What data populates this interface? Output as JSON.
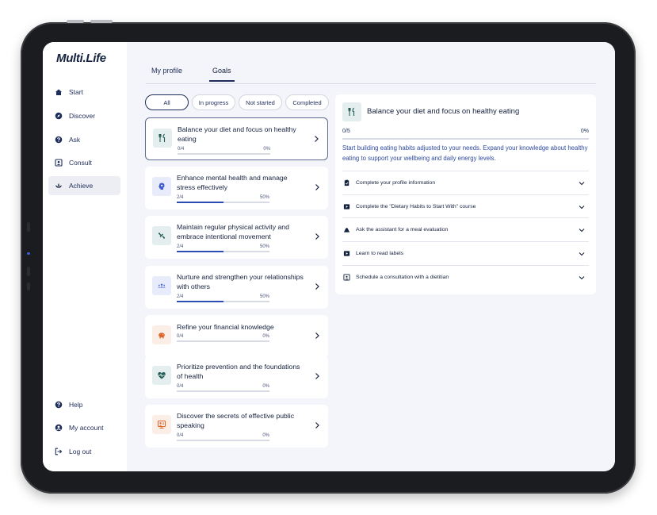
{
  "app": {
    "logo": "Multi.Life"
  },
  "sidebar": {
    "items": [
      {
        "label": "Start",
        "icon": "home-icon"
      },
      {
        "label": "Discover",
        "icon": "compass-icon"
      },
      {
        "label": "Ask",
        "icon": "question-icon"
      },
      {
        "label": "Consult",
        "icon": "consult-icon"
      },
      {
        "label": "Achieve",
        "icon": "lotus-icon",
        "active": true
      }
    ],
    "bottom_items": [
      {
        "label": "Help",
        "icon": "help-icon"
      },
      {
        "label": "My account",
        "icon": "account-icon"
      },
      {
        "label": "Log out",
        "icon": "logout-icon"
      }
    ]
  },
  "tabs": [
    {
      "label": "My profile"
    },
    {
      "label": "Goals",
      "active": true
    }
  ],
  "filters": [
    {
      "label": "All",
      "active": true
    },
    {
      "label": "In progress"
    },
    {
      "label": "Not started"
    },
    {
      "label": "Completed"
    }
  ],
  "goals": [
    {
      "title": "Balance your diet and focus on healthy eating",
      "progress": "0/4",
      "percent": "0%",
      "fraction": 0,
      "icon": "fork-knife-icon",
      "selected": true
    },
    {
      "title": "Enhance mental health and manage stress effectively",
      "progress": "2/4",
      "percent": "50%",
      "fraction": 0.5,
      "icon": "brain-icon"
    },
    {
      "title": "Maintain regular physical activity and embrace intentional movement",
      "progress": "2/4",
      "percent": "50%",
      "fraction": 0.5,
      "icon": "activity-icon"
    },
    {
      "title": "Nurture and strengthen your relationships with others",
      "progress": "2/4",
      "percent": "50%",
      "fraction": 0.5,
      "icon": "people-icon"
    },
    {
      "title": "Refine your financial knowledge",
      "progress": "0/4",
      "percent": "0%",
      "fraction": 0,
      "icon": "piggy-bank-icon"
    },
    {
      "title": "Prioritize prevention and the foundations of health",
      "progress": "0/4",
      "percent": "0%",
      "fraction": 0,
      "icon": "heart-pulse-icon"
    },
    {
      "title": "Discover the secrets of effective public speaking",
      "progress": "0/4",
      "percent": "0%",
      "fraction": 0,
      "icon": "speaker-icon"
    }
  ],
  "detail": {
    "title": "Balance your diet and focus on healthy eating",
    "progress": "0/5",
    "percent": "0%",
    "fraction": 0,
    "description": "Start building eating habits adjusted to your needs. Expand your knowledge about healthy eating to support your wellbeing and daily energy levels.",
    "tasks": [
      {
        "label": "Complete your profile information",
        "icon": "clipboard-icon"
      },
      {
        "label": "Complete the \"Dietary Habits to Start With\" course",
        "icon": "video-icon"
      },
      {
        "label": "Ask the assistant for a meal evaluation",
        "icon": "assistant-icon"
      },
      {
        "label": "Learn to read labels",
        "icon": "video-icon"
      },
      {
        "label": "Schedule a consultation with a dietitian",
        "icon": "calendar-person-icon"
      }
    ]
  },
  "colors": {
    "navy": "#14213d",
    "accent": "#2b4db3",
    "desc_text": "#2e4a9e",
    "teal_bg": "#e4eeee",
    "blue_bg": "#e8ecfa",
    "orange_bg": "#fbeee6",
    "orange": "#e0652b"
  }
}
